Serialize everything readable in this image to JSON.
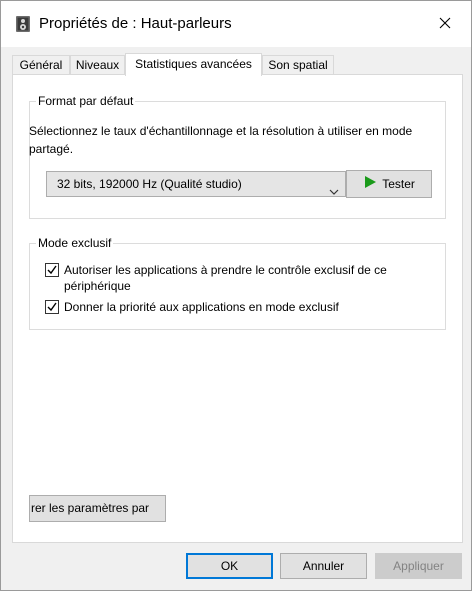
{
  "window": {
    "title": "Propriétés de : Haut-parleurs",
    "icon": "speaker-icon",
    "close_icon": "close-icon"
  },
  "tabs": [
    {
      "label": "Général",
      "active": false
    },
    {
      "label": "Niveaux",
      "active": false
    },
    {
      "label": "Statistiques avancées",
      "active": true
    },
    {
      "label": "Son spatial",
      "active": false
    }
  ],
  "format_group": {
    "title": "Format par défaut",
    "description": "Sélectionnez le taux d'échantillonnage et la résolution à utiliser en mode partagé.",
    "selected_format": "32 bits, 192000 Hz (Qualité studio)",
    "test_button": "Tester",
    "test_icon_color": "#1a9a1a"
  },
  "exclusive_group": {
    "title": "Mode exclusif",
    "options": [
      {
        "label": "Autoriser les applications à prendre le contrôle exclusif de ce périphérique",
        "checked": true
      },
      {
        "label": "Donner la priorité aux applications en mode exclusif",
        "checked": true
      }
    ]
  },
  "restore_button": "rer les paramètres par",
  "footer": {
    "ok": "OK",
    "cancel": "Annuler",
    "apply": "Appliquer"
  },
  "colors": {
    "accent": "#0078d7"
  }
}
